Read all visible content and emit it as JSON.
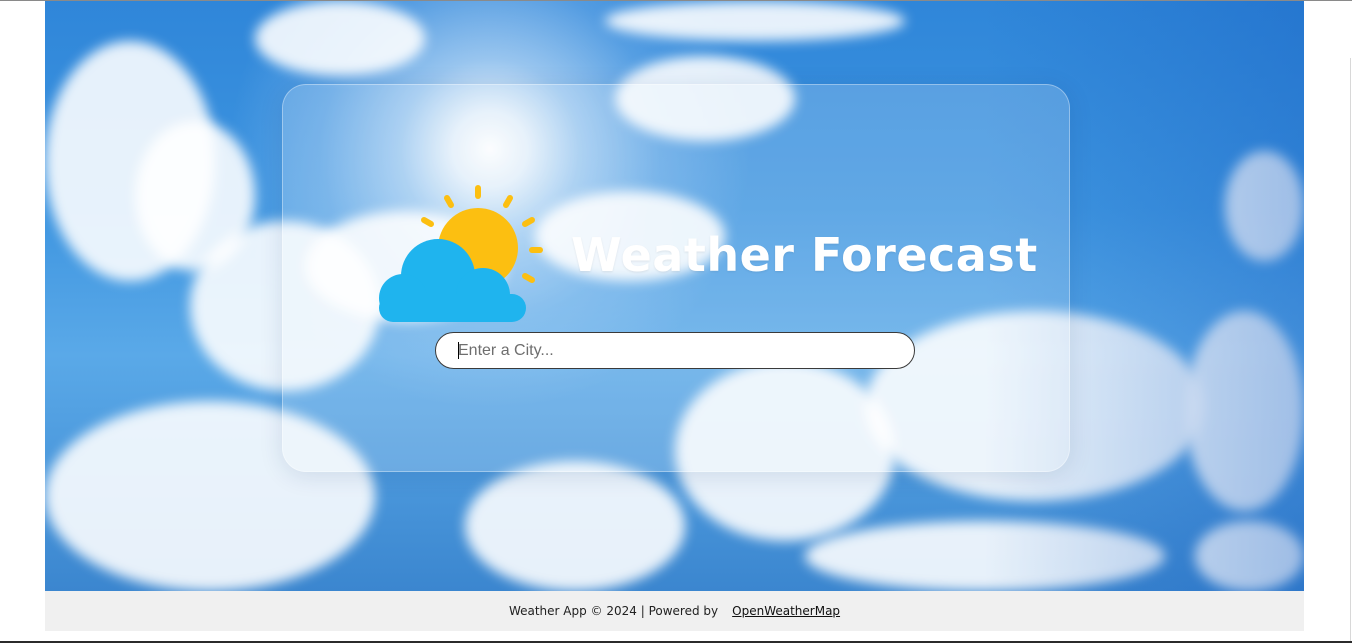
{
  "app": {
    "title": "Weather Forecast"
  },
  "search": {
    "placeholder": "Enter a City...",
    "value": ""
  },
  "footer": {
    "text": "Weather App © 2024 | Powered by",
    "link_label": "OpenWeatherMap"
  },
  "icons": {
    "logo": "sun-behind-cloud-icon"
  },
  "colors": {
    "sky": "#3e95e0",
    "sun": "#fcbf11",
    "cloud": "#1fb4ee",
    "title": "#ffffff",
    "footer_bg": "#f0f0f0"
  }
}
